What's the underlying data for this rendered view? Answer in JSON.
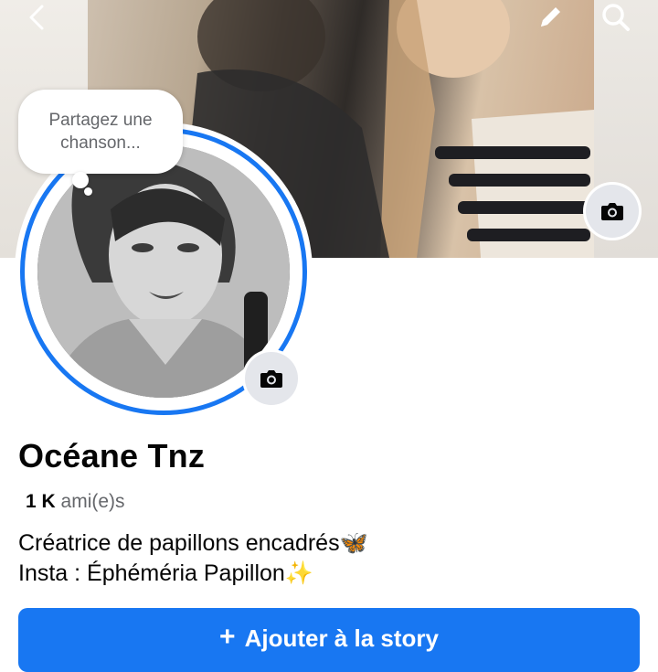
{
  "header": {
    "back_icon": "chevron-left-icon",
    "edit_icon": "pencil-icon",
    "search_icon": "search-icon"
  },
  "cover": {
    "camera_icon": "camera-icon"
  },
  "avatar": {
    "note_bubble_text": "Partagez une chanson...",
    "camera_icon": "camera-icon",
    "ring_color": "#1877f2"
  },
  "profile": {
    "name": "Océane Tnz",
    "friends_count": "1 K",
    "friends_label": "ami(e)s",
    "bio_line1": "Créatrice de papillons encadrés🦋",
    "bio_line2": "Insta : Éphéméria Papillon✨"
  },
  "actions": {
    "add_story_label": "Ajouter à la story",
    "add_story_icon": "plus-icon",
    "accent": "#1877f2"
  }
}
